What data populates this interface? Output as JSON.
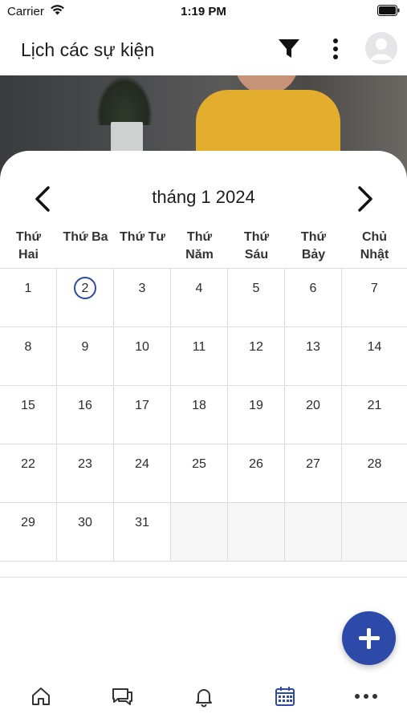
{
  "status_bar": {
    "carrier": "Carrier",
    "time": "1:19 PM",
    "wifi_icon": "wifi-icon",
    "battery_icon": "battery-icon"
  },
  "header": {
    "title": "Lịch các sự kiện",
    "filter_icon": "filter-icon",
    "more_icon": "more-vert-icon",
    "avatar_icon": "avatar-placeholder-icon"
  },
  "calendar": {
    "month_label": "tháng 1 2024",
    "prev_icon": "chevron-left-icon",
    "next_icon": "chevron-right-icon",
    "weekdays": [
      [
        "Thứ",
        "Hai"
      ],
      [
        "Thứ Ba",
        ""
      ],
      [
        "Thứ Tư",
        ""
      ],
      [
        "Thứ",
        "Năm"
      ],
      [
        "Thứ",
        "Sáu"
      ],
      [
        "Thứ",
        "Bảy"
      ],
      [
        "Chủ",
        "Nhật"
      ]
    ],
    "weeks": [
      [
        "1",
        "2",
        "3",
        "4",
        "5",
        "6",
        "7"
      ],
      [
        "8",
        "9",
        "10",
        "11",
        "12",
        "13",
        "14"
      ],
      [
        "15",
        "16",
        "17",
        "18",
        "19",
        "20",
        "21"
      ],
      [
        "22",
        "23",
        "24",
        "25",
        "26",
        "27",
        "28"
      ],
      [
        "29",
        "30",
        "31",
        "",
        "",
        "",
        ""
      ]
    ],
    "today": "2",
    "accent_color": "#2e4aa8"
  },
  "fab": {
    "icon": "plus-icon",
    "color": "#2e4aa8"
  },
  "tab_bar": {
    "tabs": [
      {
        "icon": "home-icon",
        "active": false
      },
      {
        "icon": "chat-icon",
        "active": false
      },
      {
        "icon": "bell-icon",
        "active": false
      },
      {
        "icon": "calendar-icon",
        "active": true
      },
      {
        "icon": "more-horiz-icon",
        "active": false
      }
    ],
    "active_color": "#2e4aa8",
    "inactive_color": "#333333"
  }
}
